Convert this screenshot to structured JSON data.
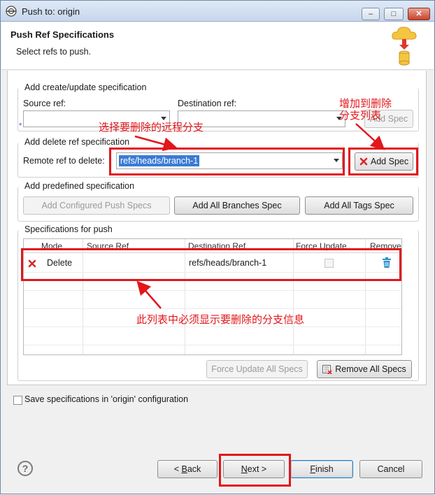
{
  "window": {
    "title": "Push to: origin",
    "minimize": "–",
    "maximize": "□",
    "close": "✕"
  },
  "header": {
    "title": "Push Ref Specifications",
    "description": "Select refs to push."
  },
  "create_update": {
    "legend": "Add create/update specification",
    "source_label": "Source ref:",
    "dest_label": "Destination ref:",
    "source_value": "",
    "dest_value": "",
    "required_mark": "*",
    "add_spec_label": "Add Spec"
  },
  "delete_ref": {
    "legend": "Add delete ref specification",
    "remote_label": "Remote ref to delete:",
    "remote_value": "refs/heads/branch-1",
    "add_spec_label": "Add Spec"
  },
  "predefined": {
    "legend": "Add predefined specification",
    "configured_label": "Add Configured Push Specs",
    "all_branches_label": "Add All Branches Spec",
    "all_tags_label": "Add All Tags Spec"
  },
  "specs": {
    "legend": "Specifications for push",
    "columns": [
      "Mode",
      "Source Ref",
      "Destination Ref",
      "Force Update",
      "Remove"
    ],
    "rows": [
      {
        "mode": "Delete",
        "source": "",
        "destination": "refs/heads/branch-1",
        "force": false
      }
    ],
    "force_update_all_label": "Force Update All Specs",
    "remove_all_label": "Remove All Specs"
  },
  "save_config": {
    "label": "Save specifications in 'origin' configuration",
    "checked": false
  },
  "footer": {
    "help": "?",
    "back_prefix": "< ",
    "back_key": "B",
    "back_rest": "ack",
    "next_prefix": "",
    "next_key": "N",
    "next_rest": "ext >",
    "finish_key": "F",
    "finish_rest": "inish",
    "cancel_label": "Cancel"
  },
  "annotations": {
    "select_remote": "选择要删除的远程分支",
    "add_to_list_line1": "增加到删除",
    "add_to_list_line2": "分支列表",
    "list_must_show": "此列表中必须显示要删除的分支信息"
  },
  "colors": {
    "annotation": "#e2161b",
    "selection": "#3a7bd5",
    "delete_icon": "#d62a2a",
    "trash_icon": "#2a8fc9"
  }
}
